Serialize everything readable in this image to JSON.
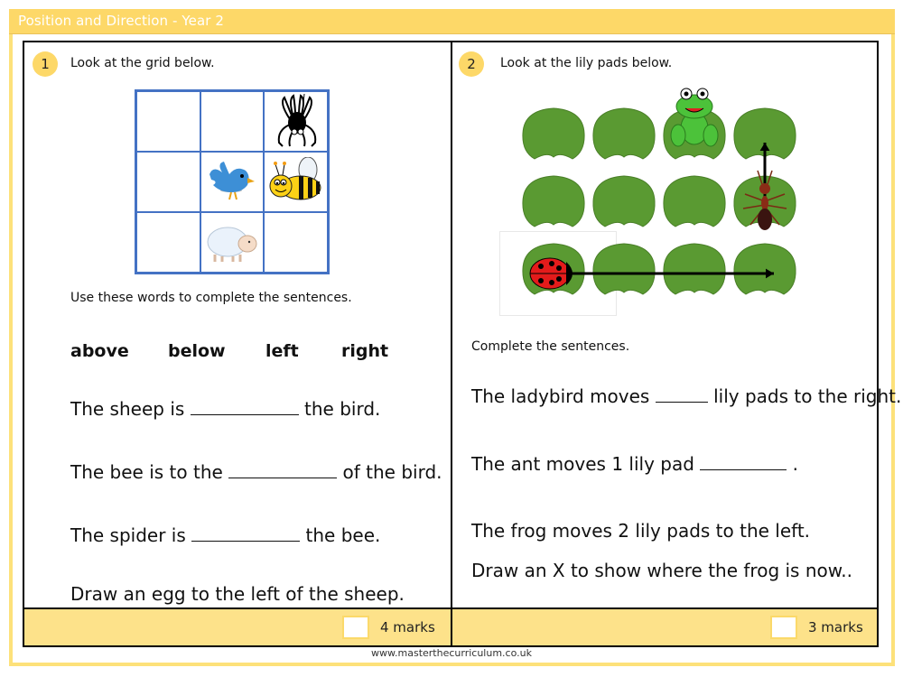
{
  "header": {
    "title": "Position and Direction - Year 2"
  },
  "question1": {
    "number": "1",
    "instruction": "Look at the grid below.",
    "grid": [
      [
        "",
        "",
        "spider"
      ],
      [
        "",
        "bird",
        "bee"
      ],
      [
        "",
        "sheep",
        ""
      ]
    ],
    "word_bank_instruction": "Use these words to complete the sentences.",
    "word_bank": [
      "above",
      "below",
      "left",
      "right"
    ],
    "sentences": [
      {
        "before": "The sheep is",
        "after": "the bird."
      },
      {
        "before": "The bee is to the",
        "after": "of the bird."
      },
      {
        "before": "The spider is",
        "after": "the bee."
      }
    ],
    "final_instruction": "Draw an egg to the left of the sheep.",
    "marks": "4 marks"
  },
  "question2": {
    "number": "2",
    "instruction": "Look at the lily pads below.",
    "lily_pad_grid": {
      "rows": 3,
      "cols": 4
    },
    "characters": [
      {
        "name": "frog",
        "row": 1,
        "col": 3
      },
      {
        "name": "ant",
        "row": 2,
        "col": 4,
        "arrow": "up",
        "arrow_length_pads": 1
      },
      {
        "name": "ladybird",
        "row": 3,
        "col": 1,
        "arrow": "right",
        "arrow_length_pads": 3
      }
    ],
    "complete_instruction": "Complete the sentences.",
    "sentences": [
      {
        "before": "The ladybird moves",
        "after": "lily pads to the right."
      },
      {
        "before": "The ant moves 1 lily pad",
        "after": "."
      }
    ],
    "frog_statement": "The frog moves 2 lily pads to the left.",
    "final_instruction": "Draw an X to show where the frog is now..",
    "marks": "3 marks"
  },
  "footer": {
    "url": "www.masterthecurriculum.co.uk"
  },
  "colors": {
    "accent": "#fdd868",
    "grid_border": "#4472c4",
    "lily_pad": "#5a9a32"
  }
}
